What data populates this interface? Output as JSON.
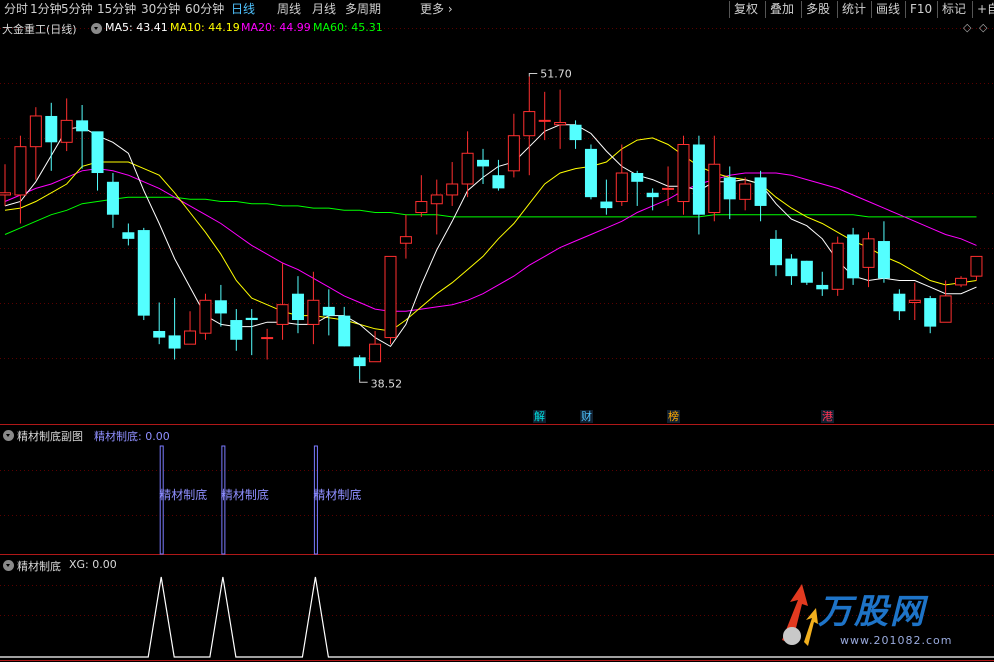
{
  "toolbar": {
    "periods": [
      "分时",
      "1分钟",
      "5分钟",
      "15分钟",
      "30分钟",
      "60分钟",
      "日线",
      "周线",
      "月线",
      "多周期",
      "更多"
    ],
    "active": "日线",
    "actions": [
      "复权",
      "叠加",
      "多股",
      "统计",
      "画线",
      "F10",
      "标记",
      "+自"
    ]
  },
  "main_panel": {
    "stock_name": "大金重工(日线)",
    "ma_labels": [
      {
        "text": "MA5: 43.41",
        "color": "#ffffff"
      },
      {
        "text": "MA10: 44.19",
        "color": "#ffff00"
      },
      {
        "text": "MA20: 44.99",
        "color": "#ff00ff"
      },
      {
        "text": "MA60: 45.31",
        "color": "#00ff00"
      }
    ],
    "high_label": "51.70",
    "low_label": "38.52"
  },
  "events": [
    {
      "text": "解",
      "color": "#00e0e0"
    },
    {
      "text": "财",
      "color": "#4fc3ff"
    },
    {
      "text": "榜",
      "color": "#ffaa00"
    },
    {
      "text": "港",
      "color": "#ff3355"
    }
  ],
  "panel2": {
    "title": "精材制底副图",
    "indicator": "精材制底: 0.00",
    "signal_label": "精材制底"
  },
  "panel3": {
    "title": "精材制底",
    "indicator": "XG: 0.00"
  },
  "logo": {
    "brand": "万股网",
    "site": "www.201082.com"
  },
  "chart_data": [
    {
      "type": "candlestick",
      "title": "大金重工(日线)",
      "ylim": [
        36.5,
        54.0
      ],
      "colors": {
        "up": "#ff3030",
        "down": "#54ffff",
        "ma5": "#ffffff",
        "ma10": "#ffff00",
        "ma20": "#ff00ff",
        "ma60": "#00ff00"
      },
      "candles": [
        [
          46.3,
          46.4,
          47.7,
          45.8
        ],
        [
          46.3,
          48.5,
          49.0,
          45.0
        ],
        [
          48.5,
          49.9,
          50.3,
          47.0
        ],
        [
          49.9,
          48.7,
          50.5,
          47.4
        ],
        [
          48.7,
          49.7,
          50.7,
          48.3
        ],
        [
          49.7,
          49.2,
          50.4,
          47.5
        ],
        [
          49.2,
          47.3,
          48.8,
          46.5
        ],
        [
          46.9,
          45.4,
          47.3,
          44.8
        ],
        [
          44.6,
          44.3,
          45.0,
          44.0
        ],
        [
          44.7,
          40.8,
          44.8,
          40.6
        ],
        [
          40.1,
          39.8,
          41.4,
          39.5
        ],
        [
          39.9,
          39.3,
          41.6,
          38.8
        ],
        [
          39.5,
          40.1,
          41.0,
          39.8
        ],
        [
          40.0,
          41.5,
          41.8,
          39.7
        ],
        [
          41.5,
          40.9,
          42.2,
          40.3
        ],
        [
          40.6,
          39.7,
          41.1,
          39.2
        ],
        [
          40.7,
          40.6,
          41.1,
          39.0
        ],
        [
          39.8,
          39.8,
          40.2,
          38.8
        ],
        [
          40.4,
          41.3,
          43.2,
          39.7
        ],
        [
          41.8,
          40.6,
          42.6,
          40.0
        ],
        [
          40.4,
          41.5,
          42.8,
          39.5
        ],
        [
          41.2,
          40.8,
          42.0,
          39.9
        ],
        [
          40.8,
          39.4,
          41.2,
          39.4
        ],
        [
          38.9,
          38.5,
          39.0,
          37.9
        ],
        [
          38.7,
          39.5,
          40.1,
          38.7
        ],
        [
          39.8,
          43.5,
          43.5,
          39.5
        ],
        [
          44.1,
          44.4,
          45.4,
          43.4
        ],
        [
          45.5,
          46.0,
          47.2,
          45.3
        ],
        [
          45.9,
          46.3,
          47.0,
          44.5
        ],
        [
          46.3,
          46.8,
          47.8,
          45.8
        ],
        [
          46.8,
          48.2,
          49.2,
          46.2
        ],
        [
          47.9,
          47.6,
          48.4,
          46.8
        ],
        [
          47.2,
          46.6,
          47.9,
          46.5
        ],
        [
          47.4,
          49.0,
          50.0,
          47.1
        ],
        [
          49.0,
          50.1,
          51.7,
          47.2
        ],
        [
          49.7,
          49.7,
          51.0,
          48.8
        ],
        [
          49.5,
          49.6,
          51.1,
          48.4
        ],
        [
          49.5,
          48.8,
          49.7,
          48.4
        ],
        [
          48.4,
          46.2,
          48.6,
          46.1
        ],
        [
          46.0,
          45.7,
          47.0,
          45.4
        ],
        [
          46.0,
          47.3,
          48.6,
          45.8
        ],
        [
          47.3,
          46.9,
          47.4,
          45.8
        ],
        [
          46.4,
          46.2,
          46.6,
          45.6
        ],
        [
          46.6,
          46.6,
          47.6,
          45.8
        ],
        [
          46.0,
          48.6,
          49.0,
          45.4
        ],
        [
          48.6,
          45.4,
          49.0,
          44.5
        ],
        [
          45.5,
          47.7,
          49.0,
          45.1
        ],
        [
          47.1,
          46.1,
          47.6,
          45.2
        ],
        [
          46.1,
          46.8,
          47.1,
          45.6
        ],
        [
          47.1,
          45.8,
          47.4,
          45.1
        ],
        [
          44.3,
          43.1,
          44.7,
          42.6
        ],
        [
          43.4,
          42.6,
          43.6,
          42.2
        ],
        [
          43.3,
          42.3,
          43.3,
          42.2
        ],
        [
          42.2,
          42.0,
          42.8,
          41.7
        ],
        [
          42.0,
          44.1,
          44.4,
          41.7
        ],
        [
          44.5,
          42.5,
          44.8,
          42.2
        ],
        [
          43.0,
          44.3,
          44.6,
          42.1
        ],
        [
          44.2,
          42.5,
          45.1,
          42.3
        ],
        [
          41.8,
          41.0,
          42.0,
          40.6
        ],
        [
          41.4,
          41.5,
          42.3,
          40.6
        ],
        [
          41.6,
          40.3,
          41.7,
          40.0
        ],
        [
          40.5,
          41.7,
          42.4,
          40.5
        ],
        [
          42.2,
          42.5,
          42.6,
          42.1
        ],
        [
          42.6,
          43.5,
          43.5,
          42.4
        ]
      ],
      "ma5": [
        45.8,
        46.0,
        46.9,
        48.1,
        49.3,
        49.4,
        49.0,
        48.7,
        48.2,
        46.5,
        45.0,
        43.4,
        42.1,
        40.8,
        40.4,
        40.3,
        40.3,
        40.5,
        40.5,
        40.4,
        40.4,
        40.8,
        40.8,
        40.4,
        39.8,
        39.4,
        40.4,
        42.2,
        43.8,
        45.1,
        46.5,
        47.1,
        47.6,
        47.8,
        48.5,
        49.2,
        49.5,
        49.5,
        49.1,
        48.3,
        47.6,
        47.2,
        47.0,
        46.7,
        46.7,
        46.5,
        46.9,
        46.9,
        47.0,
        46.8,
        45.9,
        45.2,
        44.9,
        44.3,
        43.3,
        42.6,
        42.4,
        42.5,
        42.4,
        42.4,
        42.1,
        41.8,
        41.8,
        42.1
      ],
      "ma10": [
        45.6,
        45.7,
        46.0,
        46.4,
        46.8,
        47.6,
        47.8,
        47.8,
        47.8,
        47.5,
        47.2,
        46.4,
        45.5,
        44.6,
        43.6,
        42.4,
        41.6,
        41.3,
        41.0,
        40.8,
        40.8,
        40.7,
        40.6,
        40.4,
        40.2,
        40.1,
        40.6,
        41.2,
        41.8,
        42.3,
        42.9,
        43.5,
        44.3,
        45.0,
        45.9,
        46.8,
        47.3,
        47.5,
        47.6,
        47.8,
        48.4,
        48.8,
        48.9,
        48.6,
        48.1,
        47.6,
        47.3,
        47.1,
        47.0,
        46.8,
        46.2,
        45.7,
        45.3,
        45.0,
        44.6,
        44.2,
        43.9,
        43.5,
        43.2,
        42.8,
        42.4,
        42.2,
        42.3,
        42.4
      ],
      "ma20": [
        46.0,
        46.3,
        46.6,
        46.8,
        47.1,
        47.4,
        47.5,
        47.4,
        47.2,
        46.9,
        46.6,
        46.2,
        45.8,
        45.4,
        45.0,
        44.5,
        44.0,
        43.6,
        43.2,
        42.9,
        42.5,
        42.1,
        41.7,
        41.4,
        41.1,
        41.0,
        41.0,
        41.1,
        41.2,
        41.3,
        41.5,
        41.8,
        42.2,
        42.6,
        43.1,
        43.5,
        43.9,
        44.2,
        44.5,
        44.8,
        45.1,
        45.5,
        45.8,
        46.1,
        46.5,
        46.8,
        47.0,
        47.2,
        47.3,
        47.3,
        47.3,
        47.2,
        47.0,
        46.8,
        46.6,
        46.3,
        46.0,
        45.7,
        45.4,
        45.1,
        44.8,
        44.5,
        44.3,
        44.0
      ],
      "ma60": [
        44.5,
        44.8,
        45.1,
        45.4,
        45.6,
        45.9,
        46.0,
        46.1,
        46.2,
        46.2,
        46.2,
        46.2,
        46.1,
        46.1,
        46.0,
        46.0,
        45.9,
        45.9,
        45.8,
        45.8,
        45.7,
        45.7,
        45.6,
        45.6,
        45.5,
        45.5,
        45.4,
        45.4,
        45.4,
        45.3,
        45.3,
        45.3,
        45.3,
        45.3,
        45.3,
        45.3,
        45.3,
        45.3,
        45.3,
        45.3,
        45.3,
        45.3,
        45.3,
        45.3,
        45.3,
        45.3,
        45.4,
        45.4,
        45.4,
        45.4,
        45.4,
        45.4,
        45.4,
        45.4,
        45.4,
        45.4,
        45.3,
        45.3,
        45.3,
        45.3,
        45.3,
        45.3,
        45.3,
        45.3
      ]
    },
    {
      "type": "bar",
      "title": "精材制底副图",
      "series": [
        {
          "name": "精材制底",
          "values": [
            0,
            0,
            0,
            0,
            0,
            0,
            0,
            0,
            0,
            0,
            1,
            0,
            0,
            0,
            1,
            0,
            0,
            0,
            0,
            0,
            1,
            0,
            0,
            0,
            0,
            0,
            0,
            0,
            0,
            0,
            0,
            0,
            0,
            0,
            0,
            0,
            0,
            0,
            0,
            0,
            0,
            0,
            0,
            0,
            0,
            0,
            0,
            0,
            0,
            0,
            0,
            0,
            0,
            0,
            0,
            0,
            0,
            0,
            0,
            0,
            0,
            0,
            0,
            0
          ]
        }
      ]
    },
    {
      "type": "line",
      "title": "精材制底",
      "series": [
        {
          "name": "XG",
          "values": [
            0,
            0,
            0,
            0,
            0,
            0,
            0,
            0,
            0,
            0,
            1,
            0,
            0,
            0,
            1,
            0,
            0,
            0,
            0,
            0,
            1,
            0,
            0,
            0,
            0,
            0,
            0,
            0,
            0,
            0,
            0,
            0,
            0,
            0,
            0,
            0,
            0,
            0,
            0,
            0,
            0,
            0,
            0,
            0,
            0,
            0,
            0,
            0,
            0,
            0,
            0,
            0,
            0,
            0,
            0,
            0,
            0,
            0,
            0,
            0,
            0,
            0,
            0,
            0
          ]
        }
      ]
    }
  ]
}
